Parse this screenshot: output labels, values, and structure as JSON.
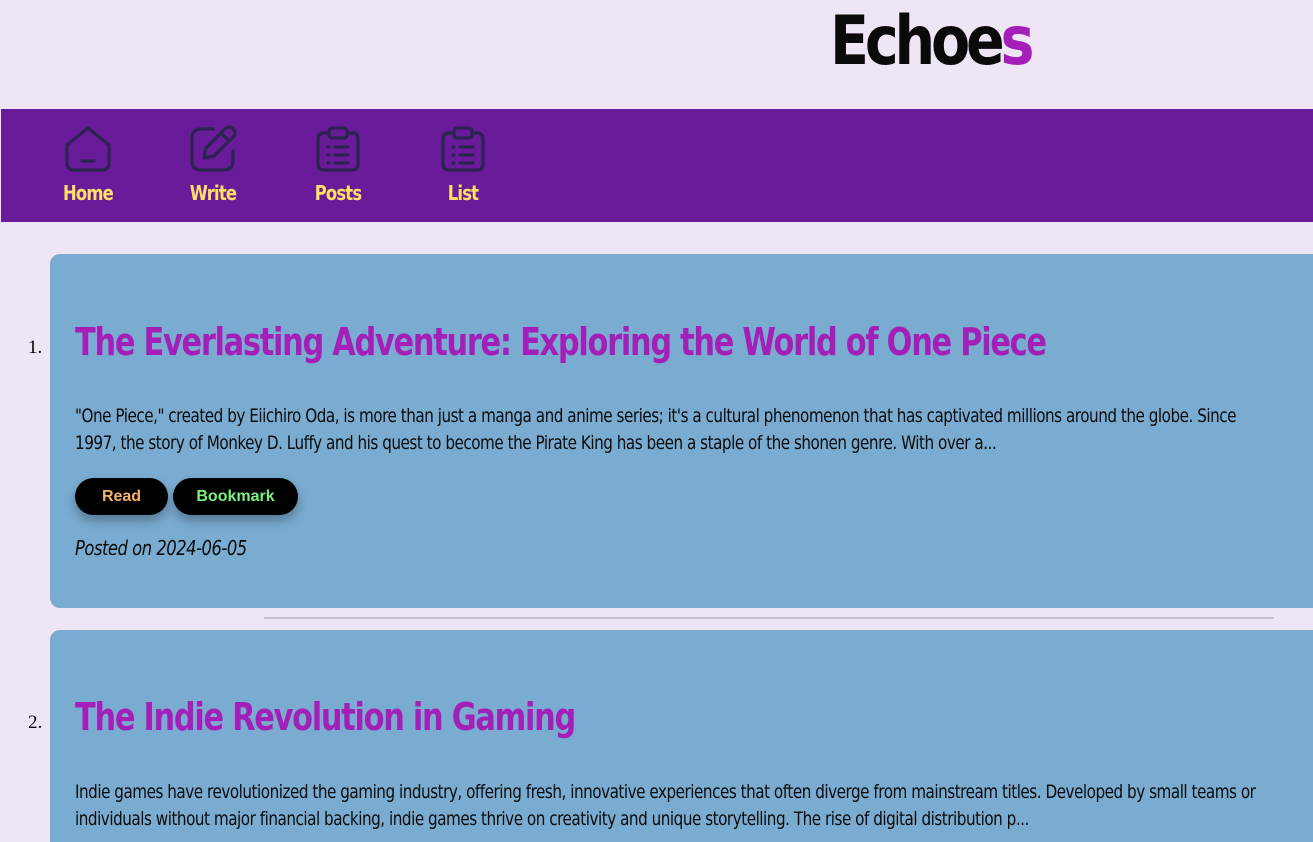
{
  "brand": {
    "name_main": "Echoe",
    "name_accent": "s"
  },
  "colors": {
    "background": "#EFE6F5",
    "nav": "#6A1B9A",
    "nav_label": "#FFE066",
    "card": "#7AABD0",
    "title": "#A41FB8",
    "read_label": "#F6B26B",
    "bookmark_label": "#7CF07C"
  },
  "nav": {
    "items": [
      {
        "label": "Home",
        "icon": "home-icon"
      },
      {
        "label": "Write",
        "icon": "edit-icon"
      },
      {
        "label": "Posts",
        "icon": "clipboard-list-icon"
      },
      {
        "label": "List",
        "icon": "clipboard-list-icon"
      }
    ]
  },
  "posts": [
    {
      "number": "1.",
      "title": "The Everlasting Adventure: Exploring the World of One Piece",
      "excerpt_line1": "\"One Piece,\" created by Eiichiro Oda, is more than just a manga and anime series; it's a cultural phenomenon that has captivated millions around the globe. Since",
      "excerpt_line2": "1997, the story of Monkey D. Luffy and his quest to become the Pirate King has been a staple of the shonen genre. With over a...",
      "read_label": "Read",
      "bookmark_label": "Bookmark",
      "date": "Posted on 2024-06-05"
    },
    {
      "number": "2.",
      "title": "The Indie Revolution in Gaming",
      "excerpt_line1": "Indie games have revolutionized the gaming industry, offering fresh, innovative experiences that often diverge from mainstream titles. Developed by small teams or",
      "excerpt_line2": "individuals without major financial backing, indie games thrive on creativity and unique storytelling. The rise of digital distribution p..."
    }
  ]
}
